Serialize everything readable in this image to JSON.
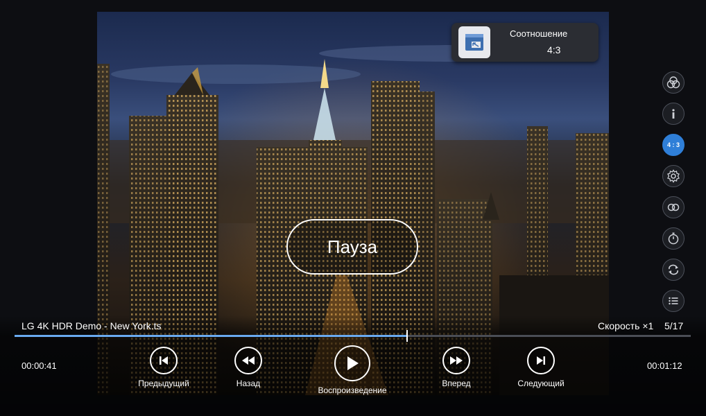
{
  "overlay": {
    "ratio_panel": {
      "title": "Соотношение",
      "value": "4:3",
      "icon": "aspect-ratio-icon"
    },
    "pause_label": "Пауза"
  },
  "side_menu": [
    {
      "name": "picture-mode",
      "icon": "color-circles-icon"
    },
    {
      "name": "info",
      "icon": "info-icon"
    },
    {
      "name": "aspect-ratio",
      "icon": "ratio-icon",
      "label": "4 : 3",
      "active": true
    },
    {
      "name": "settings",
      "icon": "gear-icon"
    },
    {
      "name": "repeat-mode",
      "icon": "link-rings-icon"
    },
    {
      "name": "sleep-timer",
      "icon": "stopwatch-icon"
    },
    {
      "name": "continuous-play",
      "icon": "repeat-icon"
    },
    {
      "name": "playlist",
      "icon": "list-icon"
    }
  ],
  "player": {
    "file_name": "LG 4K HDR Demo - New York.ts",
    "speed": "Скорость ×1",
    "counter": "5/17",
    "progress": 0.58,
    "elapsed": "00:00:41",
    "total": "00:01:12",
    "controls": {
      "previous": "Предыдущий",
      "rewind": "Назад",
      "play": "Воспроизведение",
      "forward": "Вперед",
      "next": "Следующий"
    }
  },
  "colors": {
    "accent": "#2f7fd8",
    "progress": "#6aaaf0",
    "text": "#ffffff"
  }
}
